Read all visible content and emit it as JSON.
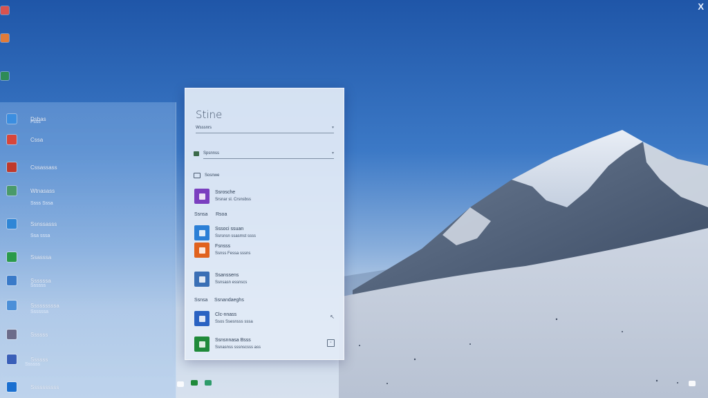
{
  "window": {
    "close_glyph": "X"
  },
  "start_menu": {
    "title": "Stine",
    "search_placeholder": "Wsssnrs",
    "filter_label": "Spsnnss",
    "recent_label": "Sosnwe",
    "section_1_label": "Ssnsa",
    "section_1_right": "Rsoa",
    "section_2_label": "Ssnsa",
    "section_2_right": "Ssnandaeghs",
    "apps": [
      {
        "name": "Ssrosche",
        "sub": "Srsnar sl. Crsnsbss",
        "color": "#7a3fbf",
        "icon": "note-app-icon"
      },
      {
        "name": "Sssoci ssuan",
        "sub": "Ssrsnsn ssasmst ssss",
        "color": "#2b7fd6",
        "icon": "blue-app-icon"
      },
      {
        "name": "Fsnsss",
        "sub": "Ssnss Fessa sssns",
        "color": "#e0621e",
        "icon": "orange-app-icon"
      },
      {
        "name": "Ssanssens",
        "sub": "Ssnsasn essnscs",
        "color": "#3a6fb5",
        "icon": "photo-app-icon"
      },
      {
        "name": "Clc-nnass",
        "sub": "Ssos Ssesnsss sssa",
        "color": "#2a62c2",
        "icon": "store-app-icon"
      },
      {
        "name": "Ssnsnnasa Bsss",
        "sub": "Ssnasnss sssnscsss ass",
        "color": "#1f8a3a",
        "icon": "green-app-icon"
      }
    ]
  },
  "left_panel": {
    "items": [
      {
        "label": "Dsbas",
        "sub": "Fsss",
        "color": "#3b8ee0",
        "icon": "folder-icon"
      },
      {
        "label": "Cssa",
        "sub": "",
        "color": "#d8463a",
        "icon": "people-icon"
      },
      {
        "label": "Cssassass",
        "sub": "",
        "color": "#c0392b",
        "icon": "calendar-icon"
      },
      {
        "label": "Wtnasass",
        "sub": "Ssss Sssa",
        "color": "#4a9a6a",
        "icon": "mail-icon"
      },
      {
        "label": "Ssnssasss",
        "sub": "Ssa sssa",
        "color": "#2f86d6",
        "icon": "docs-icon"
      },
      {
        "label": "Ssasssa",
        "sub": "",
        "color": "#2a9a4a",
        "icon": "sheets-icon"
      },
      {
        "label": "Ssssssa",
        "sub": "Ssssss",
        "color": "#3a7ac8",
        "icon": "photos-icon"
      },
      {
        "label": "Sssssssssa",
        "sub": "Ssssssa",
        "color": "#4b8fd8",
        "icon": "settings-icon"
      },
      {
        "label": "Ssssss",
        "sub": "",
        "color": "#6c6c8a",
        "icon": "maps-icon"
      },
      {
        "label": "Ssssss",
        "sub": "Ssssss",
        "color": "#3a5fb8",
        "icon": "store-icon"
      },
      {
        "label": "Ssssssssss",
        "sub": "",
        "color": "#1a6fd0",
        "icon": "start-icon"
      }
    ]
  }
}
